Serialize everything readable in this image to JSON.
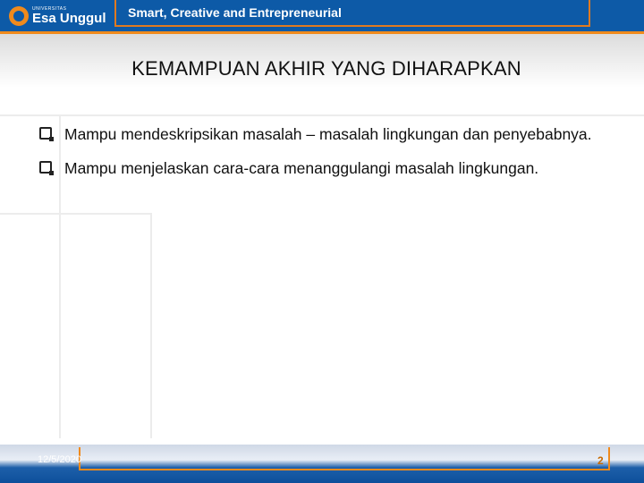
{
  "header": {
    "logo_small": "UNIVERSITAS",
    "logo_name": "Esa Unggul",
    "tagline": "Smart, Creative and Entrepreneurial"
  },
  "slide": {
    "title": "KEMAMPUAN AKHIR YANG DIHARAPKAN",
    "bullets": [
      "Mampu mendeskripsikan masalah – masalah lingkungan dan penyebabnya.",
      "Mampu menjelaskan cara-cara menanggulangi masalah lingkungan."
    ]
  },
  "footer": {
    "date": "12/5/2020",
    "page_number": "2"
  },
  "colors": {
    "brand_blue": "#0d5aa7",
    "brand_orange": "#f08a1c"
  },
  "icons": {
    "logo": "esa-unggul-logo-icon",
    "bullet": "square-bullet-icon"
  }
}
